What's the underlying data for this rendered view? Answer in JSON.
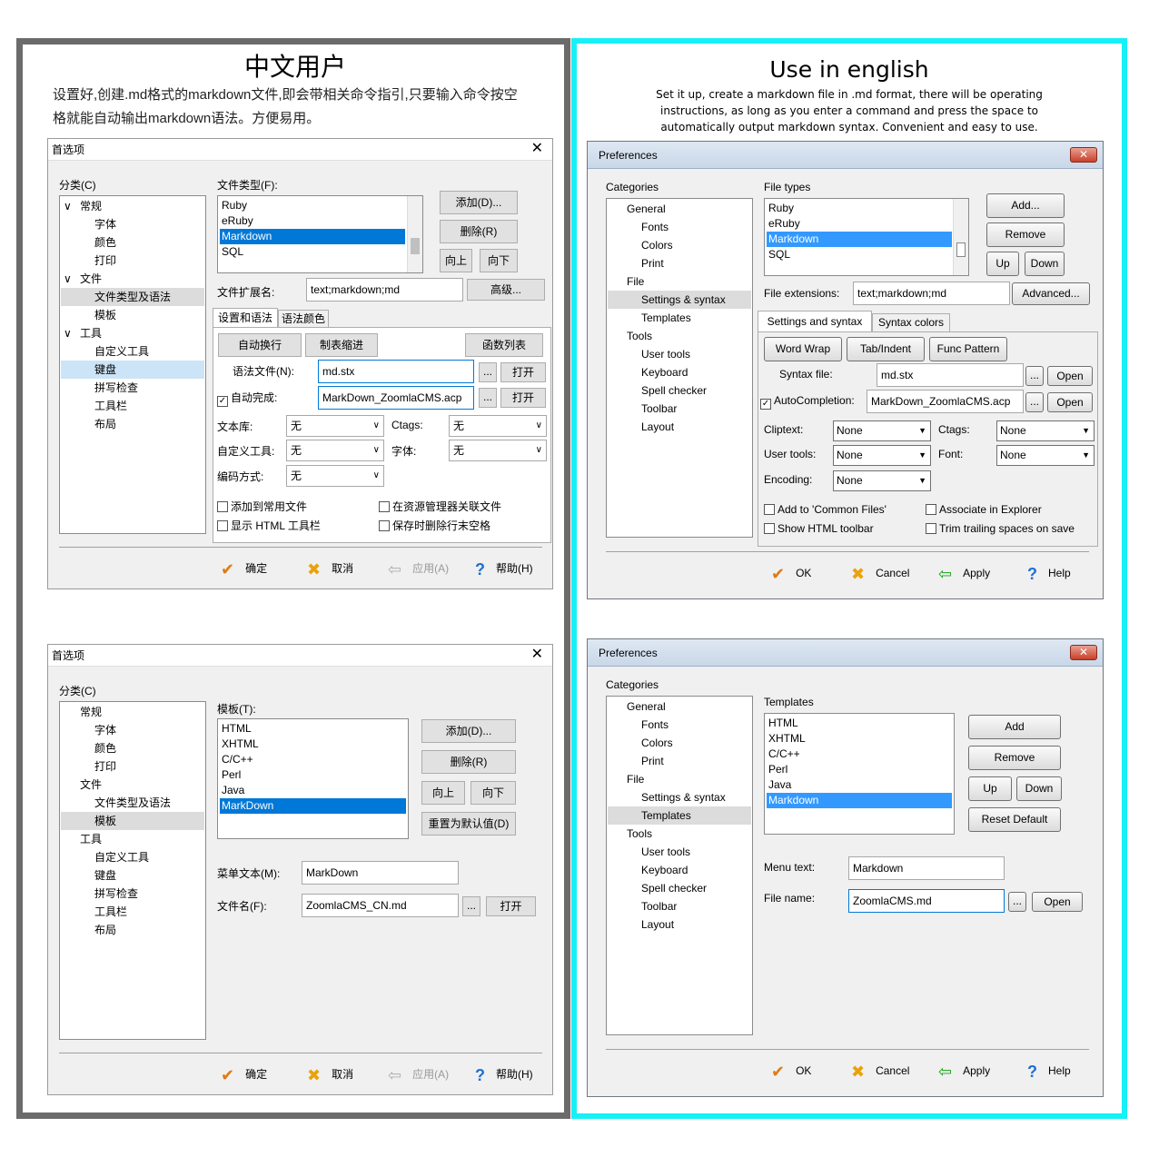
{
  "cn": {
    "title": "中文用户",
    "desc1": "设置好,创建.md格式的markdown文件,即会带相关命令指引,只要输入命令按空",
    "desc2": "格就能自动输出markdown语法。方便易用。",
    "dialog1": {
      "title": "首选项",
      "close": "✕",
      "categories_label": "分类(C)",
      "tree": [
        {
          "label": "常规",
          "expander": "∨"
        },
        {
          "label": "字体"
        },
        {
          "label": "颜色"
        },
        {
          "label": "打印"
        },
        {
          "label": "文件",
          "expander": "∨"
        },
        {
          "label": "文件类型及语法"
        },
        {
          "label": "模板"
        },
        {
          "label": "工具",
          "expander": "∨"
        },
        {
          "label": "自定义工具"
        },
        {
          "label": "键盘"
        },
        {
          "label": "拼写检查"
        },
        {
          "label": "工具栏"
        },
        {
          "label": "布局"
        }
      ],
      "filetypes_label": "文件类型(F):",
      "filetypes": [
        "Ruby",
        "eRuby",
        "Markdown",
        "SQL"
      ],
      "add": "添加(D)...",
      "remove": "删除(R)",
      "up": "向上",
      "down": "向下",
      "ext_label": "文件扩展名:",
      "ext_value": "text;markdown;md",
      "advanced": "高级...",
      "tab1": "设置和语法",
      "tab2": "语法颜色",
      "wordwrap": "自动换行",
      "tabindent": "制表缩进",
      "funcpattern": "函数列表",
      "syntax_label": "语法文件(N):",
      "syntax_value": "md.stx",
      "dots": "...",
      "open": "打开",
      "autocomp_label": "自动完成:",
      "autocomp_value": "MarkDown_ZoomlaCMS.acp",
      "cliptext_label": "文本库:",
      "none": "无",
      "ctags_label": "Ctags:",
      "usertools_label": "自定义工具:",
      "font_label": "字体:",
      "encoding_label": "编码方式:",
      "chk1": "添加到常用文件",
      "chk2": "在资源管理器关联文件",
      "chk3": "显示 HTML 工具栏",
      "chk4": "保存时删除行末空格",
      "ok": "确定",
      "cancel": "取消",
      "apply": "应用(A)",
      "help": "帮助(H)"
    },
    "dialog2": {
      "title": "首选项",
      "close": "✕",
      "categories_label": "分类(C)",
      "tree": [
        "常规",
        "字体",
        "颜色",
        "打印",
        "文件",
        "文件类型及语法",
        "模板",
        "工具",
        "自定义工具",
        "键盘",
        "拼写检查",
        "工具栏",
        "布局"
      ],
      "templates_label": "模板(T):",
      "templates": [
        "HTML",
        "XHTML",
        "C/C++",
        "Perl",
        "Java",
        "MarkDown"
      ],
      "add": "添加(D)...",
      "remove": "删除(R)",
      "up": "向上",
      "down": "向下",
      "reset": "重置为默认值(D)",
      "menu_label": "菜单文本(M):",
      "menu_value": "MarkDown",
      "file_label": "文件名(F):",
      "file_value": "ZoomlaCMS_CN.md",
      "dots": "...",
      "open": "打开",
      "ok": "确定",
      "cancel": "取消",
      "apply": "应用(A)",
      "help": "帮助(H)"
    }
  },
  "en": {
    "title": "Use in english",
    "desc1": "Set it up, create a markdown file in .md format, there will be operating",
    "desc2": "instructions, as long as you enter a command and press the space to",
    "desc3": "automatically output markdown syntax. Convenient and easy to use.",
    "dialog1": {
      "title": "Preferences",
      "close": "✕",
      "categories_label": "Categories",
      "tree": [
        "General",
        "Fonts",
        "Colors",
        "Print",
        "File",
        "Settings & syntax",
        "Templates",
        "Tools",
        "User tools",
        "Keyboard",
        "Spell checker",
        "Toolbar",
        "Layout"
      ],
      "filetypes_label": "File types",
      "filetypes": [
        "Ruby",
        "eRuby",
        "Markdown",
        "SQL"
      ],
      "add": "Add...",
      "remove": "Remove",
      "up": "Up",
      "down": "Down",
      "ext_label": "File extensions:",
      "ext_value": "text;markdown;md",
      "advanced": "Advanced...",
      "tab1": "Settings and syntax",
      "tab2": "Syntax colors",
      "wordwrap": "Word Wrap",
      "tabindent": "Tab/Indent",
      "funcpattern": "Func Pattern",
      "syntax_label": "Syntax file:",
      "syntax_value": "md.stx",
      "dots": "...",
      "open": "Open",
      "autocomp_label": "AutoCompletion:",
      "autocomp_value": "MarkDown_ZoomlaCMS.acp",
      "cliptext_label": "Cliptext:",
      "none": "None",
      "ctags_label": "Ctags:",
      "usertools_label": "User tools:",
      "font_label": "Font:",
      "encoding_label": "Encoding:",
      "chk1": "Add to 'Common Files'",
      "chk2": "Associate in Explorer",
      "chk3": "Show HTML toolbar",
      "chk4": "Trim trailing spaces on save",
      "ok": "OK",
      "cancel": "Cancel",
      "apply": "Apply",
      "help": "Help"
    },
    "dialog2": {
      "title": "Preferences",
      "close": "✕",
      "categories_label": "Categories",
      "tree": [
        "General",
        "Fonts",
        "Colors",
        "Print",
        "File",
        "Settings & syntax",
        "Templates",
        "Tools",
        "User tools",
        "Keyboard",
        "Spell checker",
        "Toolbar",
        "Layout"
      ],
      "templates_label": "Templates",
      "templates": [
        "HTML",
        "XHTML",
        "C/C++",
        "Perl",
        "Java",
        "Markdown"
      ],
      "add": "Add",
      "remove": "Remove",
      "up": "Up",
      "down": "Down",
      "reset": "Reset Default",
      "menu_label": "Menu text:",
      "menu_value": "Markdown",
      "file_label": "File name:",
      "file_value": "ZoomlaCMS.md",
      "dots": "...",
      "open": "Open",
      "ok": "OK",
      "cancel": "Cancel",
      "apply": "Apply",
      "help": "Help"
    }
  },
  "colors": {
    "cn_border": "#6b6b6b",
    "en_border": "#16f0f6",
    "selection": "#0078d7"
  }
}
